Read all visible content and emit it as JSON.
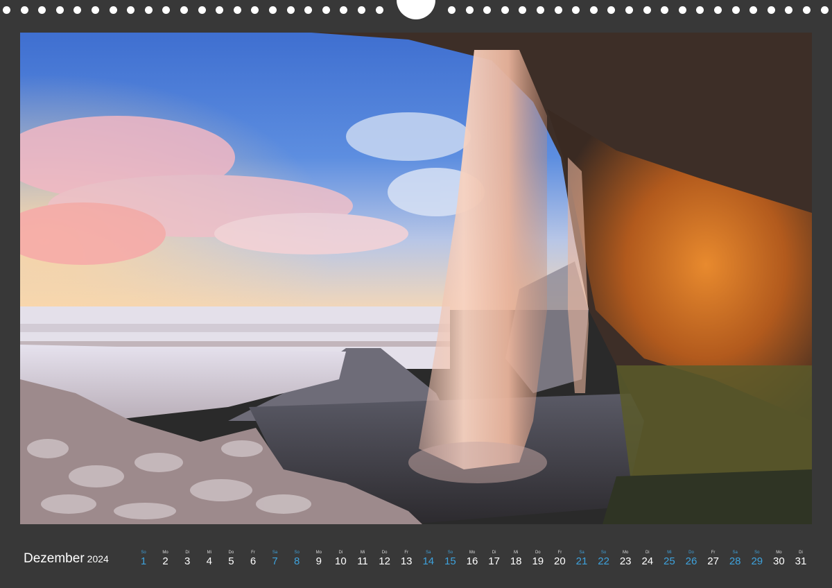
{
  "calendar": {
    "month": "Dezember",
    "year": "2024",
    "days": [
      {
        "dow": "So",
        "num": "1",
        "weekend": true
      },
      {
        "dow": "Mo",
        "num": "2",
        "weekend": false
      },
      {
        "dow": "Di",
        "num": "3",
        "weekend": false
      },
      {
        "dow": "Mi",
        "num": "4",
        "weekend": false
      },
      {
        "dow": "Do",
        "num": "5",
        "weekend": false
      },
      {
        "dow": "Fr",
        "num": "6",
        "weekend": false
      },
      {
        "dow": "Sa",
        "num": "7",
        "weekend": true
      },
      {
        "dow": "So",
        "num": "8",
        "weekend": true
      },
      {
        "dow": "Mo",
        "num": "9",
        "weekend": false
      },
      {
        "dow": "Di",
        "num": "10",
        "weekend": false
      },
      {
        "dow": "Mi",
        "num": "11",
        "weekend": false
      },
      {
        "dow": "Do",
        "num": "12",
        "weekend": false
      },
      {
        "dow": "Fr",
        "num": "13",
        "weekend": false
      },
      {
        "dow": "Sa",
        "num": "14",
        "weekend": true
      },
      {
        "dow": "So",
        "num": "15",
        "weekend": true
      },
      {
        "dow": "Mo",
        "num": "16",
        "weekend": false
      },
      {
        "dow": "Di",
        "num": "17",
        "weekend": false
      },
      {
        "dow": "Mi",
        "num": "18",
        "weekend": false
      },
      {
        "dow": "Do",
        "num": "19",
        "weekend": false
      },
      {
        "dow": "Fr",
        "num": "20",
        "weekend": false
      },
      {
        "dow": "Sa",
        "num": "21",
        "weekend": true
      },
      {
        "dow": "So",
        "num": "22",
        "weekend": true
      },
      {
        "dow": "Mo",
        "num": "23",
        "weekend": false
      },
      {
        "dow": "Di",
        "num": "24",
        "weekend": false
      },
      {
        "dow": "Mi",
        "num": "25",
        "weekend": true
      },
      {
        "dow": "Do",
        "num": "26",
        "weekend": true
      },
      {
        "dow": "Fr",
        "num": "27",
        "weekend": false
      },
      {
        "dow": "Sa",
        "num": "28",
        "weekend": true
      },
      {
        "dow": "So",
        "num": "29",
        "weekend": true
      },
      {
        "dow": "Mo",
        "num": "30",
        "weekend": false
      },
      {
        "dow": "Di",
        "num": "31",
        "weekend": false
      }
    ]
  },
  "colors": {
    "background": "#383838",
    "weekend": "#3ea2dc",
    "text": "#ffffff"
  }
}
